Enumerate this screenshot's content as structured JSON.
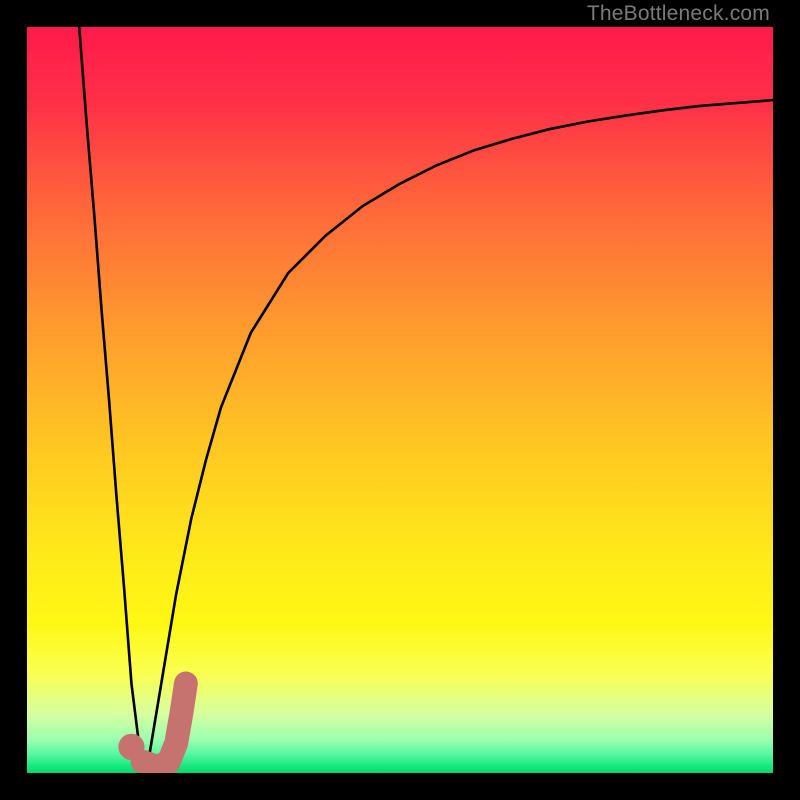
{
  "watermark": "TheBottleneck.com",
  "colors": {
    "frame": "#000000",
    "gradient_stops": [
      {
        "offset": 0.0,
        "color": "#ff1a4b"
      },
      {
        "offset": 0.1,
        "color": "#ff2f47"
      },
      {
        "offset": 0.25,
        "color": "#ff6a3a"
      },
      {
        "offset": 0.4,
        "color": "#ff9a2e"
      },
      {
        "offset": 0.55,
        "color": "#ffc423"
      },
      {
        "offset": 0.7,
        "color": "#ffe81a"
      },
      {
        "offset": 0.8,
        "color": "#fff814"
      },
      {
        "offset": 0.87,
        "color": "#f9ff55"
      },
      {
        "offset": 0.92,
        "color": "#d7ffa0"
      },
      {
        "offset": 0.955,
        "color": "#9dffb0"
      },
      {
        "offset": 0.975,
        "color": "#55f7a2"
      },
      {
        "offset": 0.99,
        "color": "#18e97e"
      },
      {
        "offset": 1.0,
        "color": "#06d96a"
      }
    ],
    "curve": "#000000",
    "marker": "#c6736f"
  },
  "chart_data": {
    "type": "line",
    "title": "",
    "xlabel": "",
    "ylabel": "",
    "xlim": [
      0,
      100
    ],
    "ylim": [
      0,
      100
    ],
    "series": [
      {
        "name": "left-arm",
        "x": [
          7,
          8,
          9,
          10,
          11,
          12,
          13,
          14,
          15,
          16
        ],
        "values": [
          100,
          87,
          75,
          62,
          50,
          37,
          25,
          12,
          4,
          0
        ]
      },
      {
        "name": "right-arm",
        "x": [
          16,
          17,
          18,
          19,
          20,
          22,
          24,
          26,
          30,
          35,
          40,
          45,
          50,
          55,
          60,
          65,
          70,
          75,
          80,
          85,
          90,
          95,
          100
        ],
        "values": [
          0,
          6,
          12,
          18,
          24,
          34,
          42,
          49,
          59,
          67,
          72,
          76,
          79,
          81.5,
          83.5,
          85,
          86.3,
          87.3,
          88.1,
          88.8,
          89.4,
          89.8,
          90.2
        ]
      }
    ],
    "marker": {
      "name": "J-marker",
      "stroke_width_pct": 3.2,
      "dot": {
        "x": 14.0,
        "y": 3.5
      },
      "path": [
        {
          "x": 15.5,
          "y": 1.5
        },
        {
          "x": 17.5,
          "y": 0.8
        },
        {
          "x": 19.0,
          "y": 1.5
        },
        {
          "x": 20.0,
          "y": 4.0
        },
        {
          "x": 20.7,
          "y": 8.0
        },
        {
          "x": 21.3,
          "y": 12.0
        }
      ]
    }
  }
}
